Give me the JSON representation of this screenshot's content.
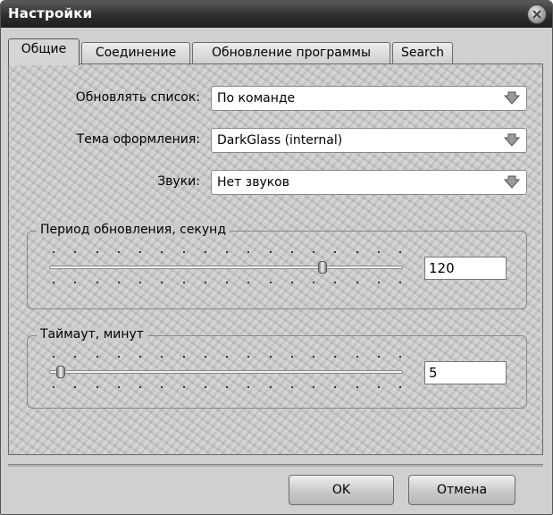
{
  "window": {
    "title": "Настройки"
  },
  "tabs": [
    {
      "label": "Общие",
      "active": true
    },
    {
      "label": "Соединение",
      "active": false
    },
    {
      "label": "Обновление программы",
      "active": false
    },
    {
      "label": "Search",
      "active": false
    }
  ],
  "fields": {
    "update_list": {
      "label": "Обновлять список:",
      "value": "По команде"
    },
    "theme": {
      "label": "Тема оформления:",
      "value": "DarkGlass (internal)"
    },
    "sounds": {
      "label": "Звуки:",
      "value": "Нет звуков"
    }
  },
  "update_period": {
    "title": "Период обновления, секунд",
    "value": "120",
    "level": 0.78
  },
  "timeout": {
    "title": "Таймаут, минут",
    "value": "5",
    "level": 0.02
  },
  "buttons": {
    "ok": "OK",
    "cancel": "Отмена"
  },
  "icons": {
    "close": "close-icon",
    "dropdown": "chevron-down-icon"
  }
}
